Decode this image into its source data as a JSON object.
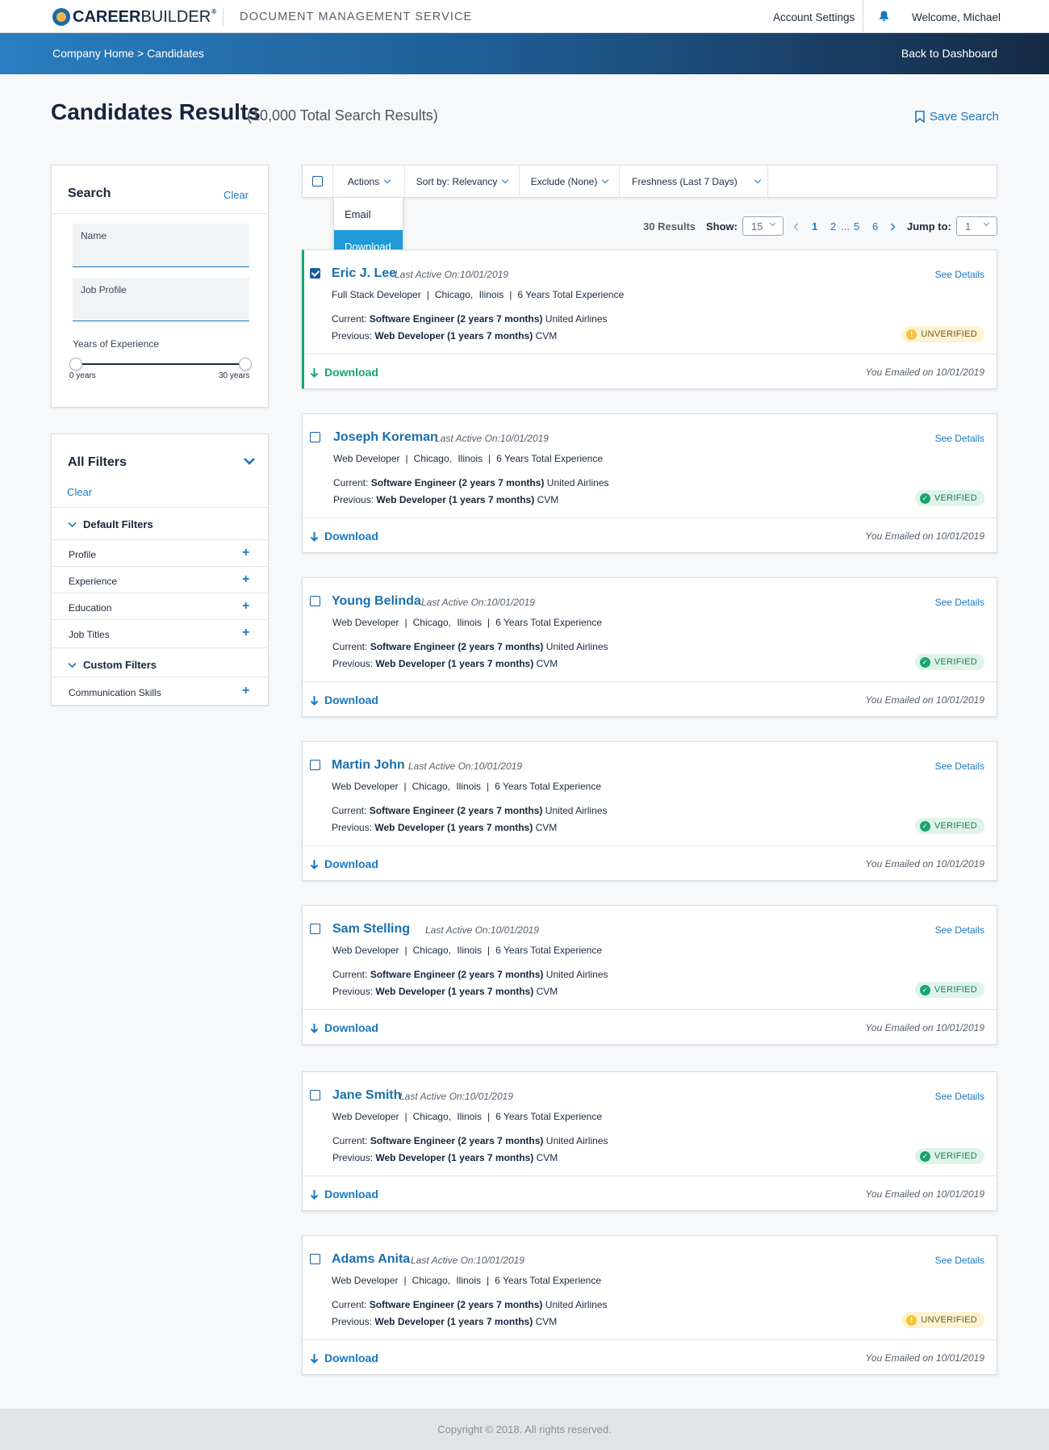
{
  "header": {
    "logo_bold": "CAREER",
    "logo_light": "BUILDER",
    "logo_reg": "®",
    "app_name": "DOCUMENT MANAGEMENT SERVICE",
    "account_settings": "Account Settings",
    "welcome": "Welcome, Michael"
  },
  "banner": {
    "breadcrumb": "Company Home > Candidates",
    "back_link": "Back to Dashboard"
  },
  "page": {
    "title": "Candidates Results",
    "total": "(10,000 Total Search Results)",
    "save_search": "Save Search"
  },
  "search_panel": {
    "title": "Search",
    "clear": "Clear",
    "name_label": "Name",
    "name_value": "",
    "job_profile_label": "Job Profile",
    "job_profile_value": "",
    "experience_label": "Years of Experience",
    "experience_min": "0 years",
    "experience_max": "30 years"
  },
  "filters_panel": {
    "title": "All Filters",
    "clear": "Clear",
    "default_section": "Default Filters",
    "default_items": [
      "Profile",
      "Experience",
      "Education",
      "Job Titles"
    ],
    "custom_section": "Custom Filters",
    "custom_items": [
      "Communication Skills"
    ]
  },
  "toolbar": {
    "actions": "Actions",
    "sort": "Sort by: Relevancy",
    "exclude": "Exclude (None)",
    "freshness": "Freshness (Last 7 Days)",
    "actions_menu": [
      "Email",
      "Download"
    ],
    "actions_selected": "Download"
  },
  "pagination": {
    "results": "30 Results",
    "show_label": "Show:",
    "show_value": "15",
    "pages": [
      "1",
      "2",
      "...",
      "5",
      "6"
    ],
    "jump_label": "Jump to:",
    "jump_value": "1"
  },
  "candidates": [
    {
      "name": "Eric J. Lee",
      "last_active": "Last Active On:10/01/2019",
      "role": "Full Stack Developer",
      "city": "Chicago,",
      "state": "Ilinois",
      "experience": "6 Years Total Experience",
      "current_title": "Software Engineer (2 years 7 months)",
      "current_company": "United Airlines",
      "previous_title": "Web Developer (1 years 7 months)",
      "previous_company": "CVM",
      "status": "UNVERIFIED",
      "emailed": "You Emailed on 10/01/2019",
      "checked": true
    },
    {
      "name": "Joseph Koreman",
      "last_active": "Last Active On:10/01/2019",
      "role": "Web Developer",
      "city": "Chicago,",
      "state": "Ilinois",
      "experience": "6 Years Total Experience",
      "current_title": "Software Engineer (2 years 7 months)",
      "current_company": "United Airlines",
      "previous_title": "Web Developer (1 years 7 months)",
      "previous_company": "CVM",
      "status": "VERIFIED",
      "emailed": "You Emailed on 10/01/2019",
      "checked": false
    },
    {
      "name": "Young Belinda",
      "last_active": "Last Active On:10/01/2019",
      "role": "Web Developer",
      "city": "Chicago,",
      "state": "Ilinois",
      "experience": "6 Years Total Experience",
      "current_title": "Software Engineer (2 years 7 months)",
      "current_company": "United Airlines",
      "previous_title": "Web Developer (1 years 7 months)",
      "previous_company": "CVM",
      "status": "VERIFIED",
      "emailed": "You Emailed on 10/01/2019",
      "checked": false
    },
    {
      "name": "Martin John",
      "last_active": "Last Active On:10/01/2019",
      "role": "Web Developer",
      "city": "Chicago,",
      "state": "Ilinois",
      "experience": "6 Years Total Experience",
      "current_title": "Software Engineer (2 years 7 months)",
      "current_company": "United Airlines",
      "previous_title": "Web Developer (1 years 7 months)",
      "previous_company": "CVM",
      "status": "VERIFIED",
      "emailed": "You Emailed on 10/01/2019",
      "checked": false
    },
    {
      "name": "Sam Stelling",
      "last_active": "Last Active On:10/01/2019",
      "role": "Web Developer",
      "city": "Chicago,",
      "state": "Ilinois",
      "experience": "6 Years Total Experience",
      "current_title": "Software Engineer (2 years 7 months)",
      "current_company": "United Airlines",
      "previous_title": "Web Developer (1 years 7 months)",
      "previous_company": "CVM",
      "status": "VERIFIED",
      "emailed": "You Emailed on 10/01/2019",
      "checked": false
    },
    {
      "name": "Jane Smith",
      "last_active": "Last Active On:10/01/2019",
      "role": "Web Developer",
      "city": "Chicago,",
      "state": "Ilinois",
      "experience": "6 Years Total Experience",
      "current_title": "Software Engineer (2 years 7 months)",
      "current_company": "United Airlines",
      "previous_title": "Web Developer (1 years 7 months)",
      "previous_company": "CVM",
      "status": "VERIFIED",
      "emailed": "You Emailed on 10/01/2019",
      "checked": false
    },
    {
      "name": "Adams Anita",
      "last_active": "Last Active On:10/01/2019",
      "role": "Web Developer",
      "city": "Chicago,",
      "state": "Ilinois",
      "experience": "6 Years Total Experience",
      "current_title": "Software Engineer (2 years 7 months)",
      "current_company": "United Airlines",
      "previous_title": "Web Developer (1 years 7 months)",
      "previous_company": "CVM",
      "status": "UNVERIFIED",
      "emailed": "You Emailed on 10/01/2019",
      "checked": false
    }
  ],
  "labels": {
    "see_details": "See Details",
    "current": "Current:",
    "previous": "Previous:",
    "download": "Download",
    "sep": "|"
  },
  "colors": {
    "accent": "#1a78c2",
    "verified": "#19a56e",
    "unverified": "#f3c33a",
    "active_border": "#19a56e"
  },
  "footer": {
    "copyright": "Copyright © 2018. All rights reserved."
  }
}
